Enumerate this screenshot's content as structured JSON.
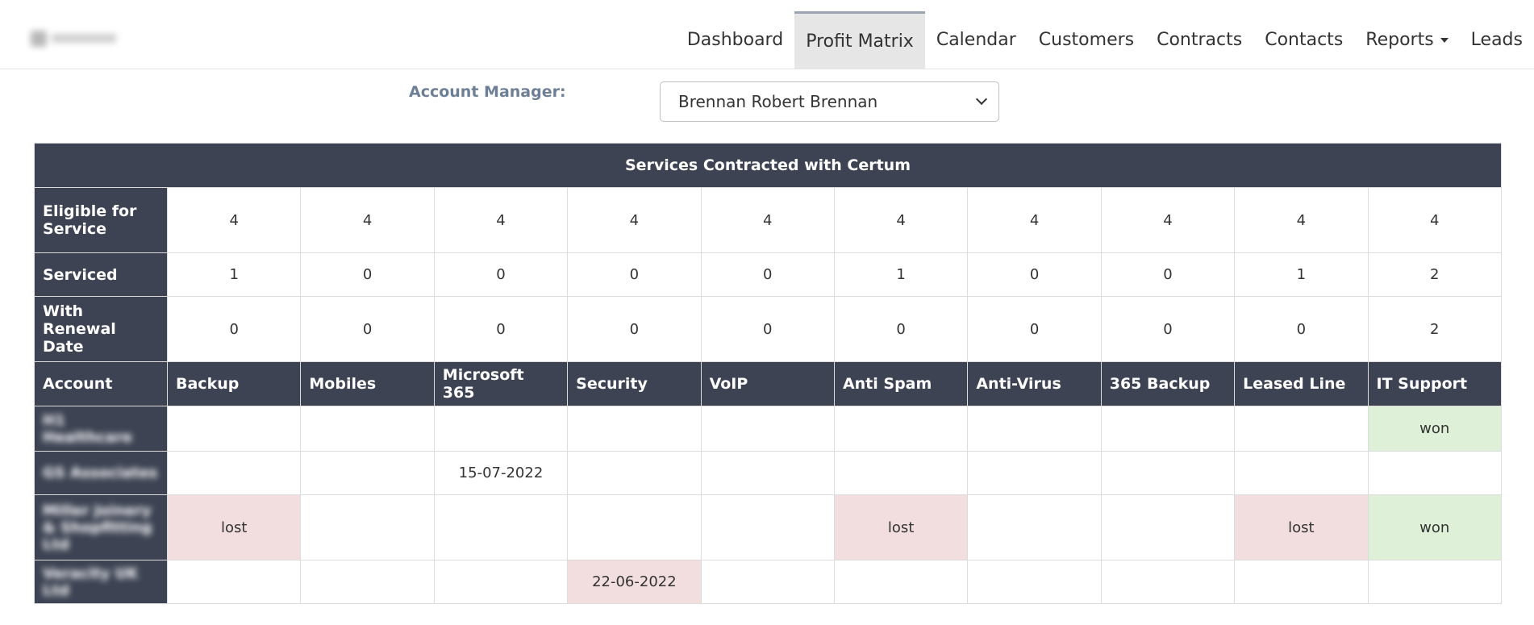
{
  "nav": {
    "items": [
      {
        "label": "Dashboard",
        "active": false
      },
      {
        "label": "Profit Matrix",
        "active": true
      },
      {
        "label": "Calendar",
        "active": false
      },
      {
        "label": "Customers",
        "active": false
      },
      {
        "label": "Contracts",
        "active": false
      },
      {
        "label": "Contacts",
        "active": false
      },
      {
        "label": "Reports",
        "active": false,
        "dropdown": true
      },
      {
        "label": "Leads",
        "active": false
      }
    ]
  },
  "filter": {
    "label": "Account Manager:",
    "selected": "Brennan Robert Brennan"
  },
  "table": {
    "title": "Services Contracted with Certum",
    "summary_rows": [
      {
        "label": "Eligible for Service",
        "values": [
          "4",
          "4",
          "4",
          "4",
          "4",
          "4",
          "4",
          "4",
          "4",
          "4"
        ]
      },
      {
        "label": "Serviced",
        "values": [
          "1",
          "0",
          "0",
          "0",
          "0",
          "1",
          "0",
          "0",
          "1",
          "2"
        ]
      },
      {
        "label": "With Renewal Date",
        "values": [
          "0",
          "0",
          "0",
          "0",
          "0",
          "0",
          "0",
          "0",
          "0",
          "2"
        ]
      }
    ],
    "account_header": "Account",
    "services": [
      "Backup",
      "Mobiles",
      "Microsoft 365",
      "Security",
      "VoIP",
      "Anti Spam",
      "Anti-Virus",
      "365 Backup",
      "Leased Line",
      "IT Support"
    ],
    "accounts": [
      {
        "name": "H1 Healthcare",
        "cells": [
          "",
          "",
          "",
          "",
          "",
          "",
          "",
          "",
          "",
          "won"
        ]
      },
      {
        "name": "GS Associates",
        "cells": [
          "",
          "",
          "15-07-2022",
          "",
          "",
          "",
          "",
          "",
          "",
          ""
        ]
      },
      {
        "name": "Miller Joinery & Shopfitting Ltd",
        "cells": [
          "lost",
          "",
          "",
          "",
          "",
          "lost",
          "",
          "",
          "lost",
          "won"
        ]
      },
      {
        "name": "Veracity UK Ltd",
        "cells": [
          "",
          "",
          "",
          "22-06-2022",
          "",
          "",
          "",
          "",
          "",
          ""
        ]
      }
    ]
  }
}
